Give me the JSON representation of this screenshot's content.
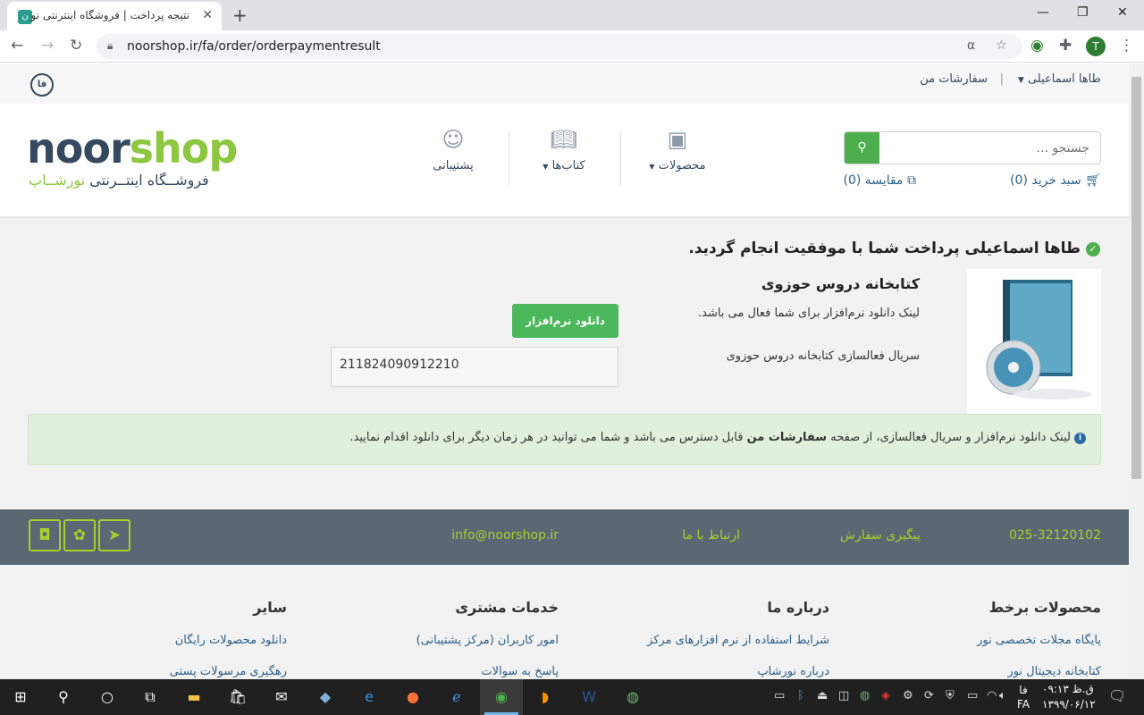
{
  "browser": {
    "tab_title": "نتیجه پرداخت | فروشگاه اینترنتی نور",
    "url": "noorshop.ir/fa/order/orderpaymentresult",
    "profile_initial": "T"
  },
  "topbar": {
    "lang_label": "فا",
    "user_menu": "طاها اسماعیلی",
    "my_orders": "سفارشات من",
    "separator": "|"
  },
  "header": {
    "logo_noor": "noor",
    "logo_shop": "shop",
    "logo_subtitle_prefix": "فروشــگاه اینتــرنتی",
    "logo_subtitle_brand": "نورشــاپ",
    "nav": {
      "support": "پشتیبانی",
      "books": "کتاب‌ها",
      "products": "محصولات"
    },
    "search_placeholder": "جستجو ...",
    "cart": "سبد خرید (0)",
    "compare": "مقایسه (0)"
  },
  "main": {
    "success_message": "طاها اسماعیلی پرداخت شما با موفقیت انجام گردید.",
    "product_title": "کتابخانه دروس حوزوی",
    "download_desc": "لینک دانلود نرم‌افزار برای شما فعال می باشد.",
    "serial_label": "سریال فعالسازی کتابخانه دروس حوزوی",
    "download_button": "دانلود نرم‌افزار",
    "serial_value": "211824090912210",
    "notice_before": "لینک دانلود نرم‌افزار و سریال فعالسازی، از صفحه",
    "notice_bold": "سفارشات من",
    "notice_after": "قابل دسترس می باشد و شما می توانید در هر زمان دیگر برای دانلود اقدام نمایید."
  },
  "footer_bar": {
    "phone": "025-32120102",
    "track_order": "پیگیری سفارش",
    "contact_us": "ارتباط با ما",
    "email": "info@noorshop.ir"
  },
  "footer": {
    "columns": [
      {
        "heading": "محصولات برخط",
        "links": [
          "پایگاه مجلات تخصصی نور",
          "کتابخانه دیجیتال نور"
        ]
      },
      {
        "heading": "درباره ما",
        "links": [
          "شرایط استفاده از نرم افزارهای مرکز",
          "درباره نورشاپ"
        ]
      },
      {
        "heading": "خدمات مشتری",
        "links": [
          "امور کاربران (مرکز پشتیبانی)",
          "پاسخ به سوالات"
        ]
      },
      {
        "heading": "سایر",
        "links": [
          "دانلود محصولات رایگان",
          "رهگیری مرسولات پستی"
        ]
      }
    ]
  },
  "taskbar": {
    "time": "ق.ظ ۰۹:۱۳",
    "date": "۱۳۹۹/۰۶/۱۲",
    "lang_top": "فا",
    "lang_bottom": "FA"
  },
  "colors": {
    "brand_dark": "#34495e",
    "brand_green": "#8dc63f",
    "button_green": "#4cb85c",
    "footer_bar": "#5a6873",
    "footer_accent": "#a3d12c"
  }
}
